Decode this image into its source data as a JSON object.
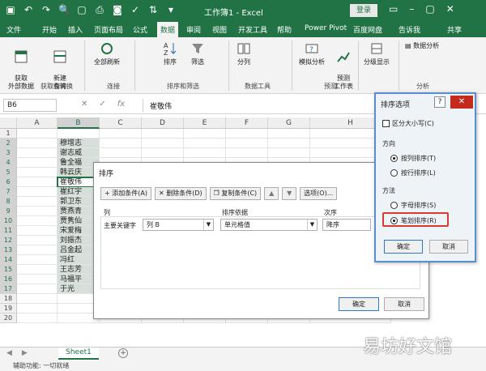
{
  "title_bar": {
    "document_title": "工作簿1 - Excel",
    "login_label": "登录"
  },
  "tabs": [
    "文件",
    "开始",
    "插入",
    "页面布局",
    "公式",
    "数据",
    "审阅",
    "视图",
    "开发工具",
    "帮助",
    "Power Pivot",
    "百度网盘"
  ],
  "active_tab": "数据",
  "tell_me": "告诉我",
  "share": "共享",
  "ribbon": {
    "get_data": "获取\n外部数据",
    "new_query": "新建\n查询",
    "refresh_all": "全部刷新",
    "sort": "排序",
    "filter": "筛选",
    "split": "分列",
    "what_if": "模拟分析",
    "forecast": "预测\n工作表",
    "outline": "分级显示",
    "data_analysis": "数据分析",
    "groups": [
      "获取和转换",
      "连接",
      "排序和筛选",
      "数据工具",
      "预测",
      "分析"
    ]
  },
  "formula_bar": {
    "name_box": "B6",
    "formula": "崔敬伟"
  },
  "columns": [
    "A",
    "B",
    "C",
    "D",
    "E",
    "F",
    "G",
    "H"
  ],
  "rows": [
    "1",
    "2",
    "3",
    "4",
    "5",
    "6",
    "7",
    "8",
    "9",
    "10",
    "11",
    "12",
    "13",
    "14",
    "15",
    "16",
    "17",
    "18",
    "19",
    "20"
  ],
  "column_b_values": [
    "",
    "穆增志",
    "谢志威",
    "鲁全福",
    "韩云庆",
    "崔敬伟",
    "崔红宇",
    "郭卫东",
    "贾燕青",
    "贾隽仙",
    "宋爱梅",
    "刘振杰",
    "吕金起",
    "冯红",
    "王志芳",
    "马福平",
    "于光"
  ],
  "sheet_tab": "Sheet1",
  "status": "辅助功能: 一切就绪",
  "sort_dialog": {
    "title": "排序",
    "add_level": "添加条件(A)",
    "delete_level": "删除条件(D)",
    "copy_level": "复制条件(C)",
    "options": "选项(O)...",
    "col_header": "列",
    "basis_header": "排序依据",
    "order_header": "次序",
    "row_label": "主要关键字",
    "column_value": "列 B",
    "basis_value": "单元格值",
    "order_value": "降序",
    "ok": "确定",
    "cancel": "取消"
  },
  "options_dialog": {
    "title": "排序选项",
    "help": "?",
    "case_sensitive": "区分大小写(C)",
    "direction_label": "方向",
    "by_column": "按列排序(T)",
    "by_row": "按行排序(L)",
    "method_label": "方法",
    "alphabetic": "字母排序(S)",
    "stroke": "笔划排序(R)",
    "ok": "确定",
    "cancel": "取消"
  },
  "colors": {
    "accent": "#217346",
    "highlight": "#d83a2f"
  },
  "watermark": "易坊好文馆"
}
